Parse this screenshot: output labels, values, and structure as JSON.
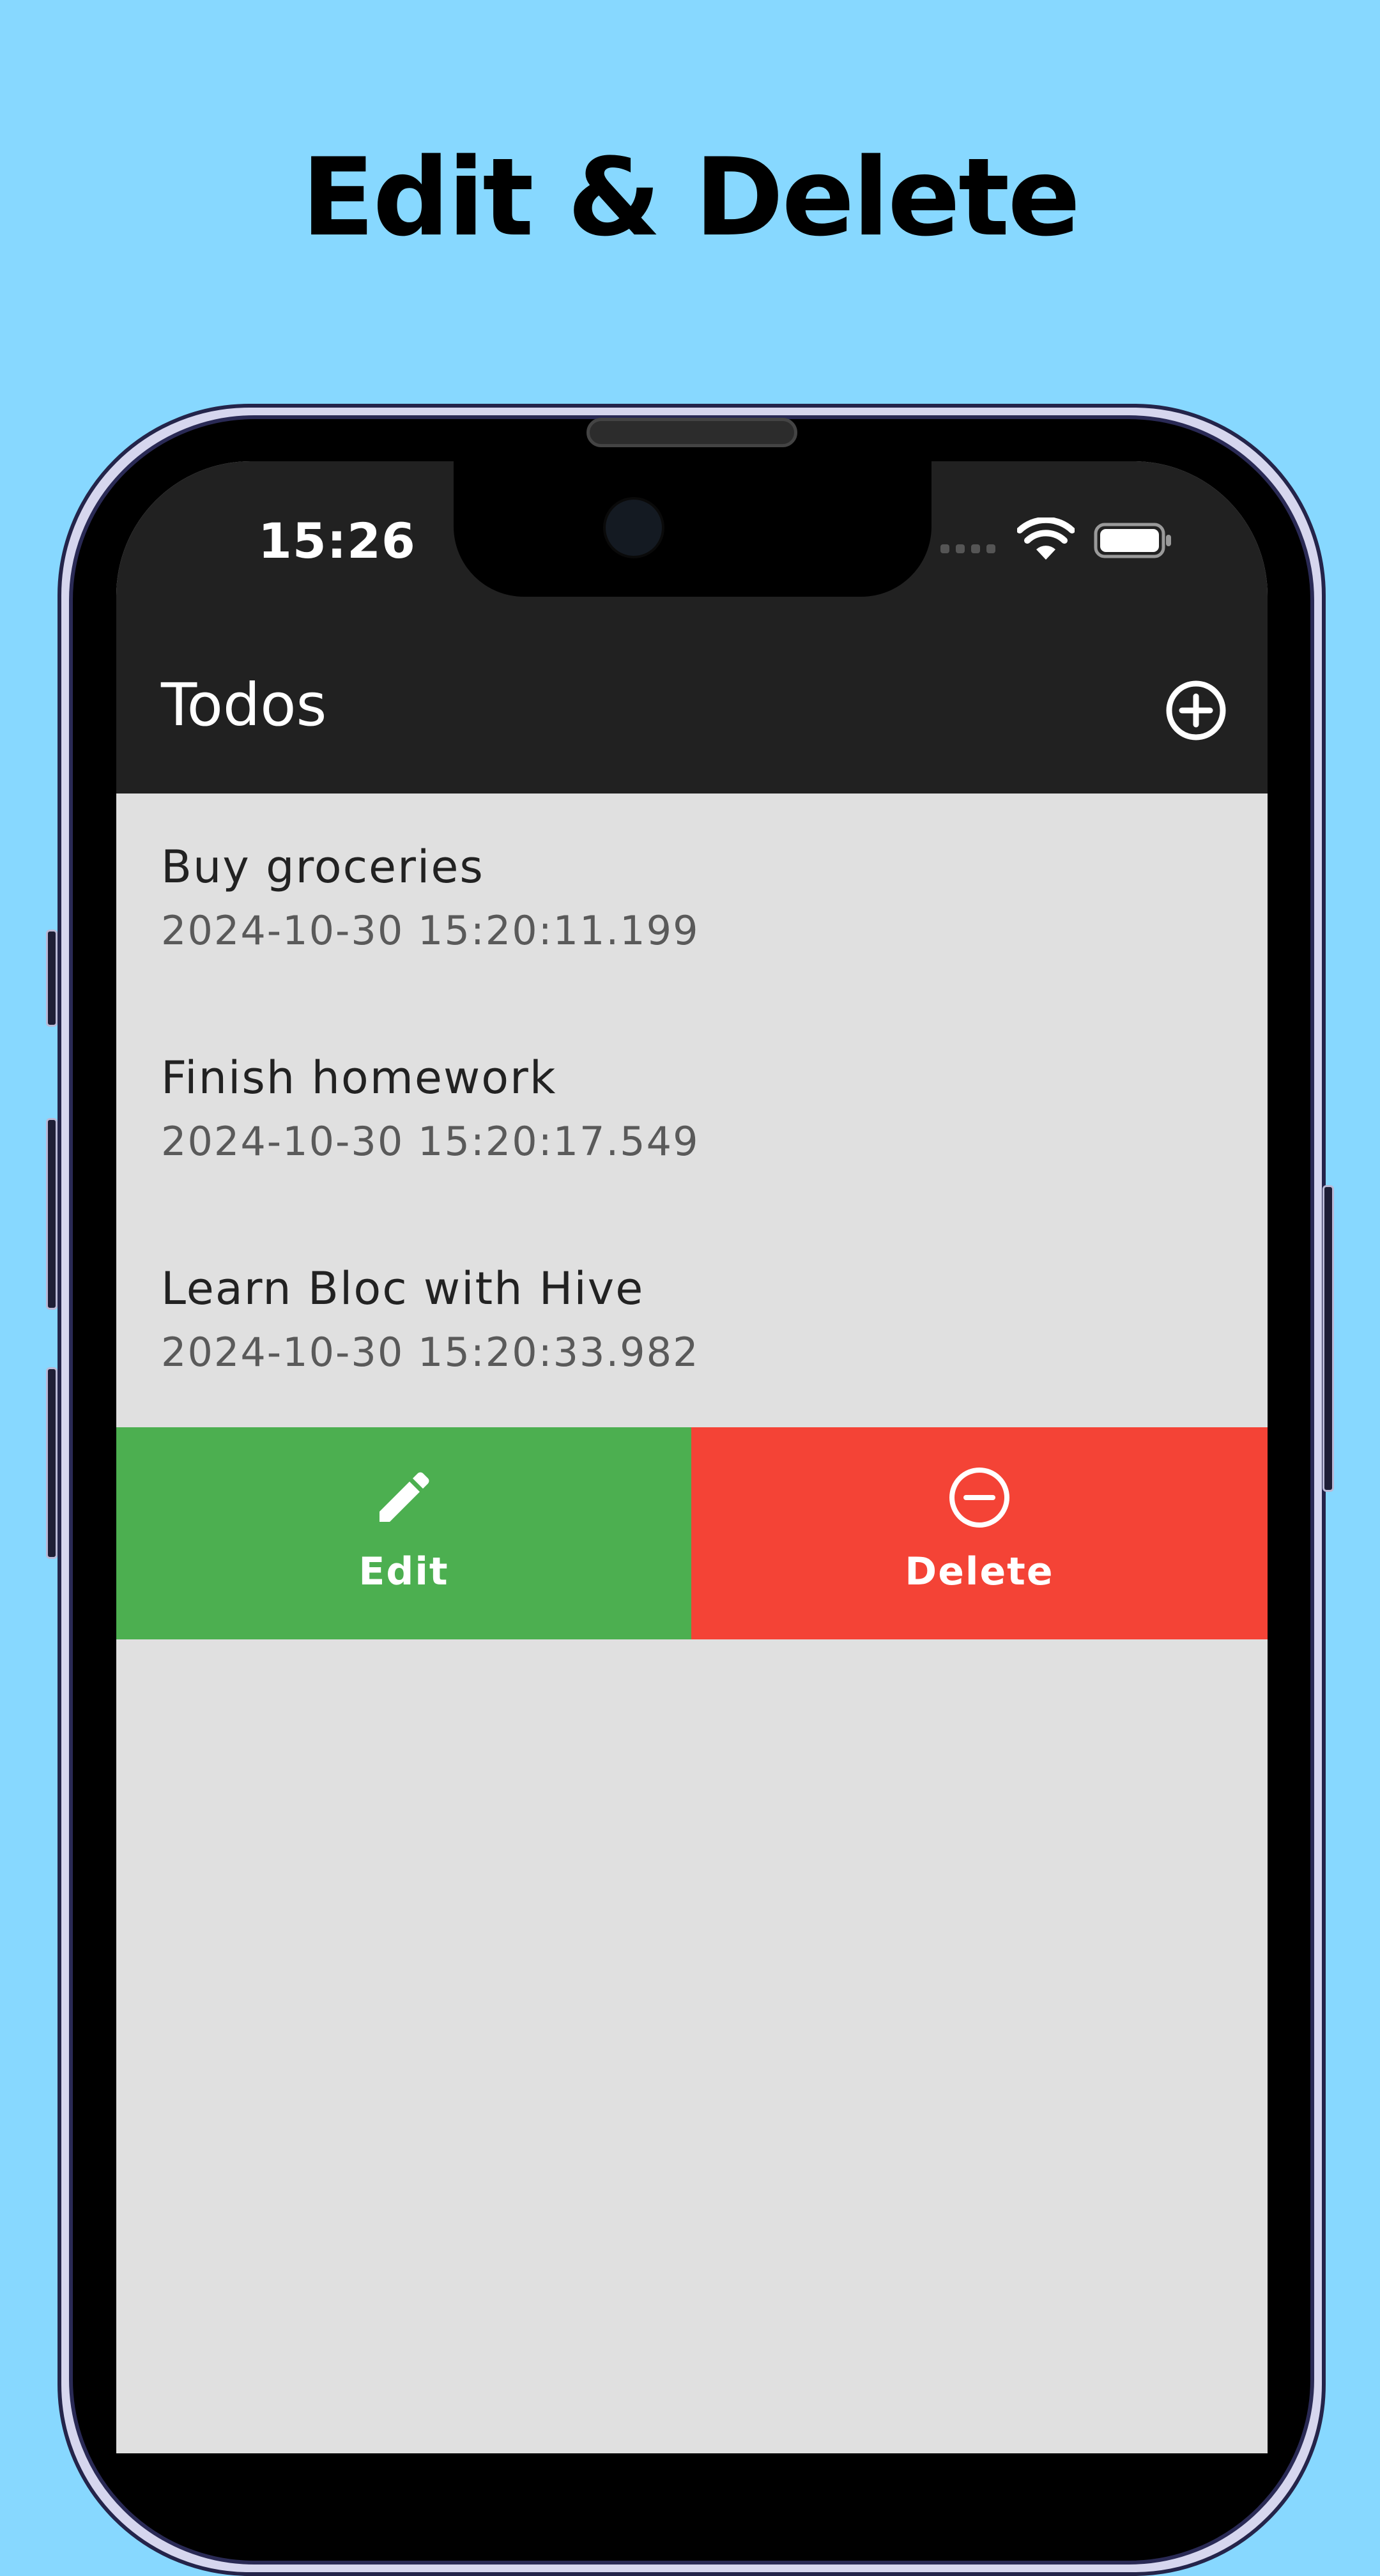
{
  "banner": {
    "headline": "Edit & Delete"
  },
  "status_bar": {
    "time": "15:26",
    "icons": [
      "cellular-signal-icon",
      "wifi-icon",
      "battery-icon"
    ]
  },
  "app_bar": {
    "title": "Todos",
    "add_icon": "add-circle-icon"
  },
  "todos": [
    {
      "title": "Buy groceries",
      "date": "2024-10-30 15:20:11.199"
    },
    {
      "title": "Finish homework",
      "date": "2024-10-30 15:20:17.549"
    },
    {
      "title": "Learn Bloc with Hive",
      "date": "2024-10-30 15:20:33.982"
    }
  ],
  "swipe_actions": {
    "edit": {
      "label": "Edit",
      "icon": "pencil-icon",
      "color": "#4caf50"
    },
    "delete": {
      "label": "Delete",
      "icon": "minus-circle-icon",
      "color": "#f44336"
    }
  },
  "colors": {
    "background": "#87d8ff",
    "app_bar": "#212121",
    "list_background": "#e0e0e0"
  }
}
